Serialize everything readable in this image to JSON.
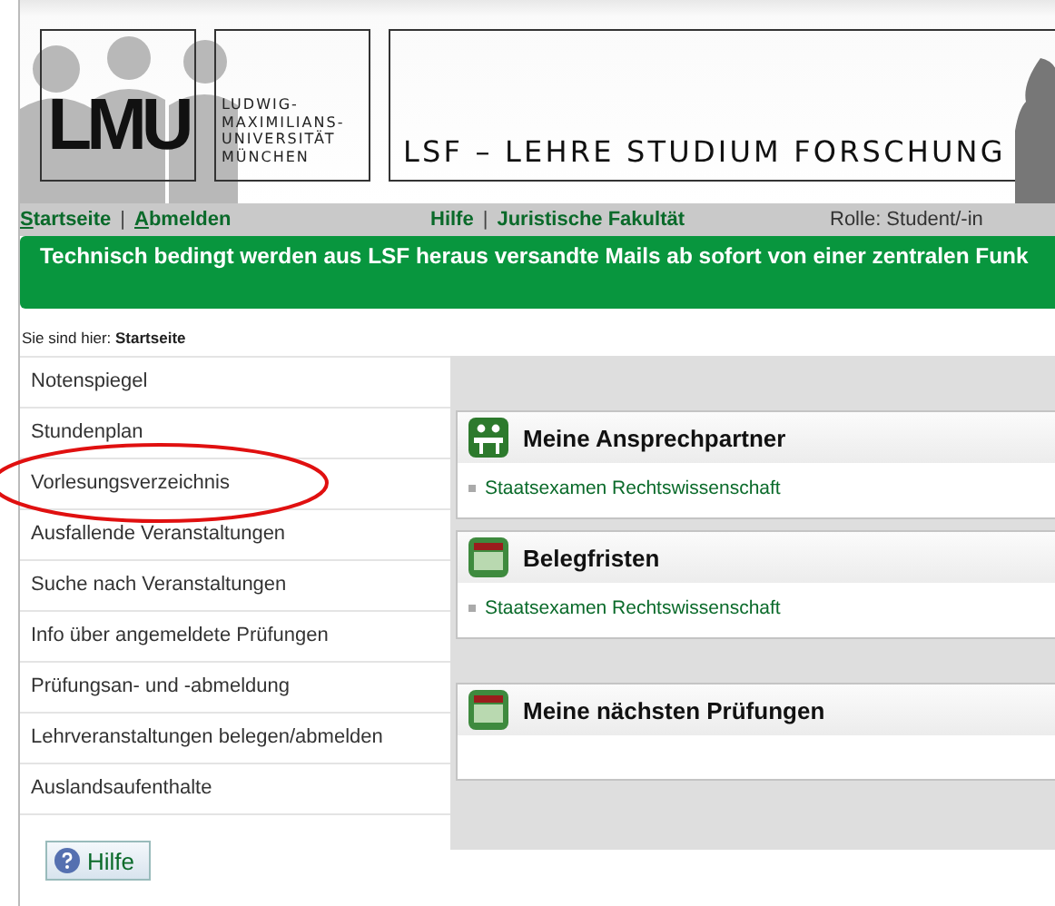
{
  "header": {
    "logo": "LMU",
    "university": [
      "LUDWIG-",
      "MAXIMILIANS-",
      "UNIVERSITÄT",
      "MÜNCHEN"
    ],
    "title": "LSF – LEHRE STUDIUM FORSCHUNG"
  },
  "nav": {
    "left": [
      "Startseite",
      "Abmelden"
    ],
    "left_separator": "|",
    "center": [
      "Hilfe",
      "Juristische Fakultät"
    ],
    "center_separator": "|",
    "role": "Rolle: Student/-in"
  },
  "banner": "Technisch bedingt werden aus LSF heraus versandte Mails ab sofort von einer zentralen Funk",
  "breadcrumb": {
    "label": "Sie sind hier:",
    "current": "Startseite"
  },
  "sidebar": {
    "items": [
      {
        "label": "Notenspiegel",
        "circled": false
      },
      {
        "label": "Stundenplan",
        "circled": false
      },
      {
        "label": "Vorlesungsverzeichnis",
        "circled": true
      },
      {
        "label": "Ausfallende Veranstaltungen",
        "circled": false
      },
      {
        "label": "Suche nach Veranstaltungen",
        "circled": false
      },
      {
        "label": "Info über angemeldete Prüfungen",
        "circled": false
      },
      {
        "label": "Prüfungsan- und -abmeldung",
        "circled": false
      },
      {
        "label": "Lehrveranstaltungen belegen/abmelden",
        "circled": false
      },
      {
        "label": "Auslandsaufenthalte",
        "circled": false
      }
    ]
  },
  "boxes": [
    {
      "kind": "people",
      "title": "Meine Ansprechpartner",
      "links": [
        "Staatsexamen Rechtswissenschaft"
      ]
    },
    {
      "kind": "calendar",
      "title": "Belegfristen",
      "links": [
        "Staatsexamen Rechtswissenschaft"
      ]
    },
    {
      "kind": "calendar",
      "title": "Meine nächsten Prüfungen"
    }
  ],
  "help_button": "Hilfe"
}
